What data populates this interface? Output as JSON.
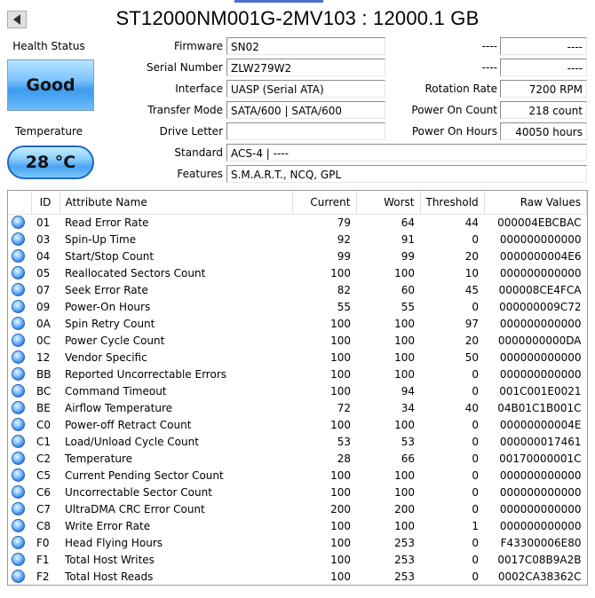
{
  "title": "ST12000NM001G-2MV103 : 12000.1 GB",
  "health": {
    "label": "Health Status",
    "value": "Good"
  },
  "temperature": {
    "label": "Temperature",
    "value": "28 °C"
  },
  "info": {
    "firmware": {
      "label": "Firmware",
      "value": "SN02"
    },
    "serial": {
      "label": "Serial Number",
      "value": "ZLW279W2"
    },
    "interface": {
      "label": "Interface",
      "value": "UASP (Serial ATA)"
    },
    "transfer_mode": {
      "label": "Transfer Mode",
      "value": "SATA/600 | SATA/600"
    },
    "drive_letter": {
      "label": "Drive Letter",
      "value": ""
    },
    "standard": {
      "label": "Standard",
      "value": "ACS-4 | ----"
    },
    "features": {
      "label": "Features",
      "value": "S.M.A.R.T., NCQ, GPL"
    }
  },
  "right_info": {
    "unknown1": {
      "label": "----",
      "value": "----"
    },
    "unknown2": {
      "label": "----",
      "value": "----"
    },
    "rotation_rate": {
      "label": "Rotation Rate",
      "value": "7200 RPM"
    },
    "power_on_count": {
      "label": "Power On Count",
      "value": "218 count"
    },
    "power_on_hours": {
      "label": "Power On Hours",
      "value": "40050 hours"
    }
  },
  "table": {
    "headers": [
      "ID",
      "Attribute Name",
      "Current",
      "Worst",
      "Threshold",
      "Raw Values"
    ],
    "rows": [
      [
        "01",
        "Read Error Rate",
        "79",
        "64",
        "44",
        "000004EBCBAC"
      ],
      [
        "03",
        "Spin-Up Time",
        "92",
        "91",
        "0",
        "000000000000"
      ],
      [
        "04",
        "Start/Stop Count",
        "99",
        "99",
        "20",
        "0000000004E6"
      ],
      [
        "05",
        "Reallocated Sectors Count",
        "100",
        "100",
        "10",
        "000000000000"
      ],
      [
        "07",
        "Seek Error Rate",
        "82",
        "60",
        "45",
        "000008CE4FCA"
      ],
      [
        "09",
        "Power-On Hours",
        "55",
        "55",
        "0",
        "000000009C72"
      ],
      [
        "0A",
        "Spin Retry Count",
        "100",
        "100",
        "97",
        "000000000000"
      ],
      [
        "0C",
        "Power Cycle Count",
        "100",
        "100",
        "20",
        "0000000000DA"
      ],
      [
        "12",
        "Vendor Specific",
        "100",
        "100",
        "50",
        "000000000000"
      ],
      [
        "BB",
        "Reported Uncorrectable Errors",
        "100",
        "100",
        "0",
        "000000000000"
      ],
      [
        "BC",
        "Command Timeout",
        "100",
        "94",
        "0",
        "001C001E0021"
      ],
      [
        "BE",
        "Airflow Temperature",
        "72",
        "34",
        "40",
        "04B01C1B001C"
      ],
      [
        "C0",
        "Power-off Retract Count",
        "100",
        "100",
        "0",
        "00000000004E"
      ],
      [
        "C1",
        "Load/Unload Cycle Count",
        "53",
        "53",
        "0",
        "000000017461"
      ],
      [
        "C2",
        "Temperature",
        "28",
        "66",
        "0",
        "00170000001C"
      ],
      [
        "C5",
        "Current Pending Sector Count",
        "100",
        "100",
        "0",
        "000000000000"
      ],
      [
        "C6",
        "Uncorrectable Sector Count",
        "100",
        "100",
        "0",
        "000000000000"
      ],
      [
        "C7",
        "UltraDMA CRC Error Count",
        "200",
        "200",
        "0",
        "000000000000"
      ],
      [
        "C8",
        "Write Error Rate",
        "100",
        "100",
        "1",
        "000000000000"
      ],
      [
        "F0",
        "Head Flying Hours",
        "100",
        "253",
        "0",
        "F43300006E80"
      ],
      [
        "F1",
        "Total Host Writes",
        "100",
        "253",
        "0",
        "0017C08B9A2B"
      ],
      [
        "F2",
        "Total Host Reads",
        "100",
        "253",
        "0",
        "0002CA38362C"
      ]
    ]
  }
}
